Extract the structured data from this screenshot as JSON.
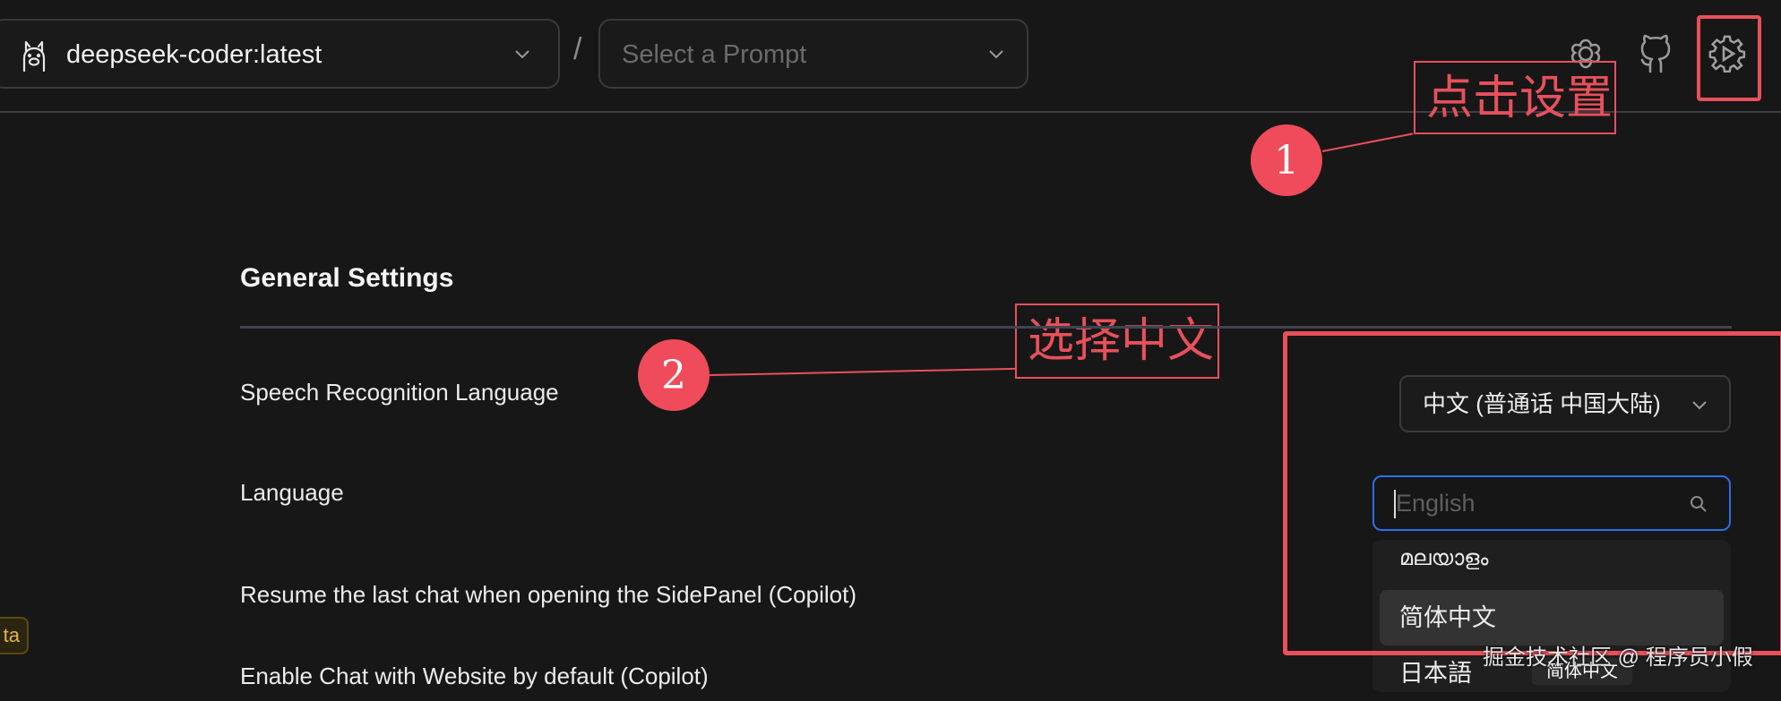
{
  "header": {
    "model_select": {
      "value": "deepseek-coder:latest"
    },
    "separator": "/",
    "prompt_select": {
      "placeholder": "Select a Prompt"
    }
  },
  "annotations": {
    "step1": {
      "number": "1",
      "text": "点击设置"
    },
    "step2": {
      "number": "2",
      "text": "选择中文"
    },
    "color": "#e8505b"
  },
  "settings": {
    "title": "General Settings",
    "rows": [
      {
        "label": "Speech Recognition Language"
      },
      {
        "label": "Language"
      },
      {
        "label": "Resume the last chat when opening the SidePanel (Copilot)"
      },
      {
        "label": "Enable Chat with Website by default (Copilot)"
      }
    ],
    "speech_language_value": "中文 (普通话 中国大陆)",
    "language_input": {
      "placeholder": "English"
    },
    "language_options": [
      "മലയാളം",
      "简体中文",
      "日本語"
    ]
  },
  "beta_tag": "ta",
  "watermark": {
    "text": "掘金技术社区 @ 程序员小假",
    "chip": "简体中文"
  },
  "icons": [
    "llama-icon",
    "chevron-down-icon",
    "ollama-gear-icon",
    "github-icon",
    "settings-gear-icon",
    "search-icon"
  ],
  "colors": {
    "accent_focus": "#2a70ea",
    "annotation": "#e8505b",
    "background": "#171717"
  }
}
